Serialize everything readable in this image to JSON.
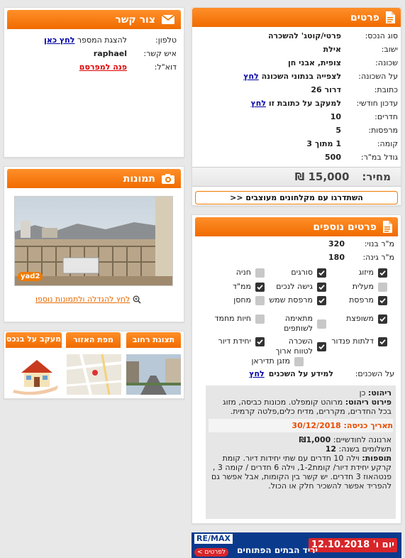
{
  "details": {
    "title": "פרטים",
    "rows": [
      {
        "label": "סוג הנכס:",
        "value": "פרטי/קוטג' להשכרה"
      },
      {
        "label": "ישוב:",
        "value": "אילת"
      },
      {
        "label": "שכונה:",
        "value": "צופית, אבני חן"
      },
      {
        "label": "על השכונה:",
        "value": "לצפייה בנתוני השכונה",
        "link": "לחץ"
      },
      {
        "label": "כתובת:",
        "value": "דרור 26"
      },
      {
        "label": "עדכון חודשי:",
        "value": "למעקב על כתובת זו",
        "link": "לחץ"
      },
      {
        "label": "חדרים:",
        "value": "10"
      },
      {
        "label": "מרפסות:",
        "value": "5"
      },
      {
        "label": "קומה:",
        "value": "1 מתוך 3"
      },
      {
        "label": "גודל במ\"ר:",
        "value": "500"
      }
    ],
    "price_label": "מחיר:",
    "price_value": "15,000 ₪",
    "vip_button": "השתדרגו עם מקלחונים מעוצבים <<"
  },
  "extra": {
    "title": "פרטים נוספים",
    "built_label": "מ\"ר בנוי:",
    "built_value": "320",
    "garden_label": "מ\"ר גינה:",
    "garden_value": "180",
    "features": [
      {
        "label": "מיזוג",
        "checked": true
      },
      {
        "label": "סורגים",
        "checked": true
      },
      {
        "label": "חניה",
        "checked": false
      },
      {
        "label": "מעלית",
        "checked": false
      },
      {
        "label": "גישה לנכים",
        "checked": true
      },
      {
        "label": "ממ\"ד",
        "checked": true
      },
      {
        "label": "מרפסת",
        "checked": true
      },
      {
        "label": "מרפסת שמש",
        "checked": true
      },
      {
        "label": "מחסן",
        "checked": false
      },
      {
        "label": "משופצת",
        "checked": true
      },
      {
        "label": "מתאימה לשותפים",
        "checked": false
      },
      {
        "label": "חיות מחמד",
        "checked": false
      },
      {
        "label": "דלתות פנדור",
        "checked": true
      },
      {
        "label": "השכרה לטווח ארוך",
        "checked": true
      },
      {
        "label": "יחידת דיור",
        "checked": true
      },
      {
        "label": "מזגן תדיראן",
        "checked": false
      }
    ],
    "residents_label": "על השכנים:",
    "residents_text": "למידע על השכנים",
    "residents_link": "לחץ"
  },
  "description": {
    "furniture_label": "ריהוט:",
    "furniture_value": "כן",
    "furniture_detail_label": "פירוט ריהוט:",
    "furniture_detail_value": "מרוהט קומפלט. מכונות כביסה, מזוג בכל החדרים, מקררים, מדיח כלים,פלטה קרמית.",
    "entry_label": "תאריך כניסה:",
    "entry_value": "30/12/2018",
    "arnona_label": "ארנונה לחודשיים:",
    "arnona_value": "₪1,000",
    "payments_label": "תשלומים בשנה:",
    "payments_value": "12",
    "extras_label": "תוספות:",
    "extras_value": "וילה 10 חדרים עם שתי יחידות דיור. קומת קרקע יחידת דיור/ קומת1-2, וילה 6 חדרים / קומה 3 , פנטהאוז 3 חדרים. יש קשר בין הקומות, אבל אפשר גם להפריד אפשר להשכיר חלק או הכול."
  },
  "contact": {
    "title": "צור קשר",
    "phone_label": "טלפון:",
    "phone_text": "להצגת המספר",
    "phone_link": "לחץ כאן",
    "person_label": "איש קשר:",
    "person_value": "raphael",
    "email_label": "דוא\"ל:",
    "email_link": "פנה למפרסם"
  },
  "images": {
    "title": "תמונות",
    "watermark": "yad2",
    "enlarge_link": "לחץ להגדלה ולתמונות נוספו"
  },
  "tabs": {
    "street": "תצוגת רחוב",
    "map": "מפת האזור",
    "track": "מעקב על בנכס"
  },
  "banner": {
    "brand": "RE/MAX",
    "text": "יריד הבתים הפתוחים",
    "date": "יום ו' 12.10.2018",
    "more": "לפרטים >"
  }
}
